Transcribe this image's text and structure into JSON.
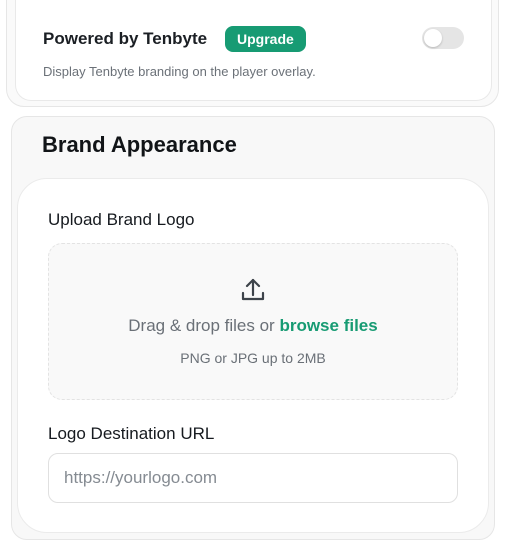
{
  "powered_by": {
    "title": "Powered by Tenbyte",
    "badge": "Upgrade",
    "description": "Display Tenbyte branding on the player overlay.",
    "toggle_on": false
  },
  "brand": {
    "title": "Brand Appearance",
    "upload": {
      "label": "Upload Brand Logo",
      "drag_text": "Drag & drop files or ",
      "browse_text": "browse files",
      "hint": "PNG or JPG up to 2MB",
      "icon": "upload-icon"
    },
    "url": {
      "label": "Logo Destination URL",
      "placeholder": "https://yourlogo.com",
      "value": ""
    }
  },
  "colors": {
    "accent": "#179b73",
    "toggle_off": "#e5e5e5"
  }
}
